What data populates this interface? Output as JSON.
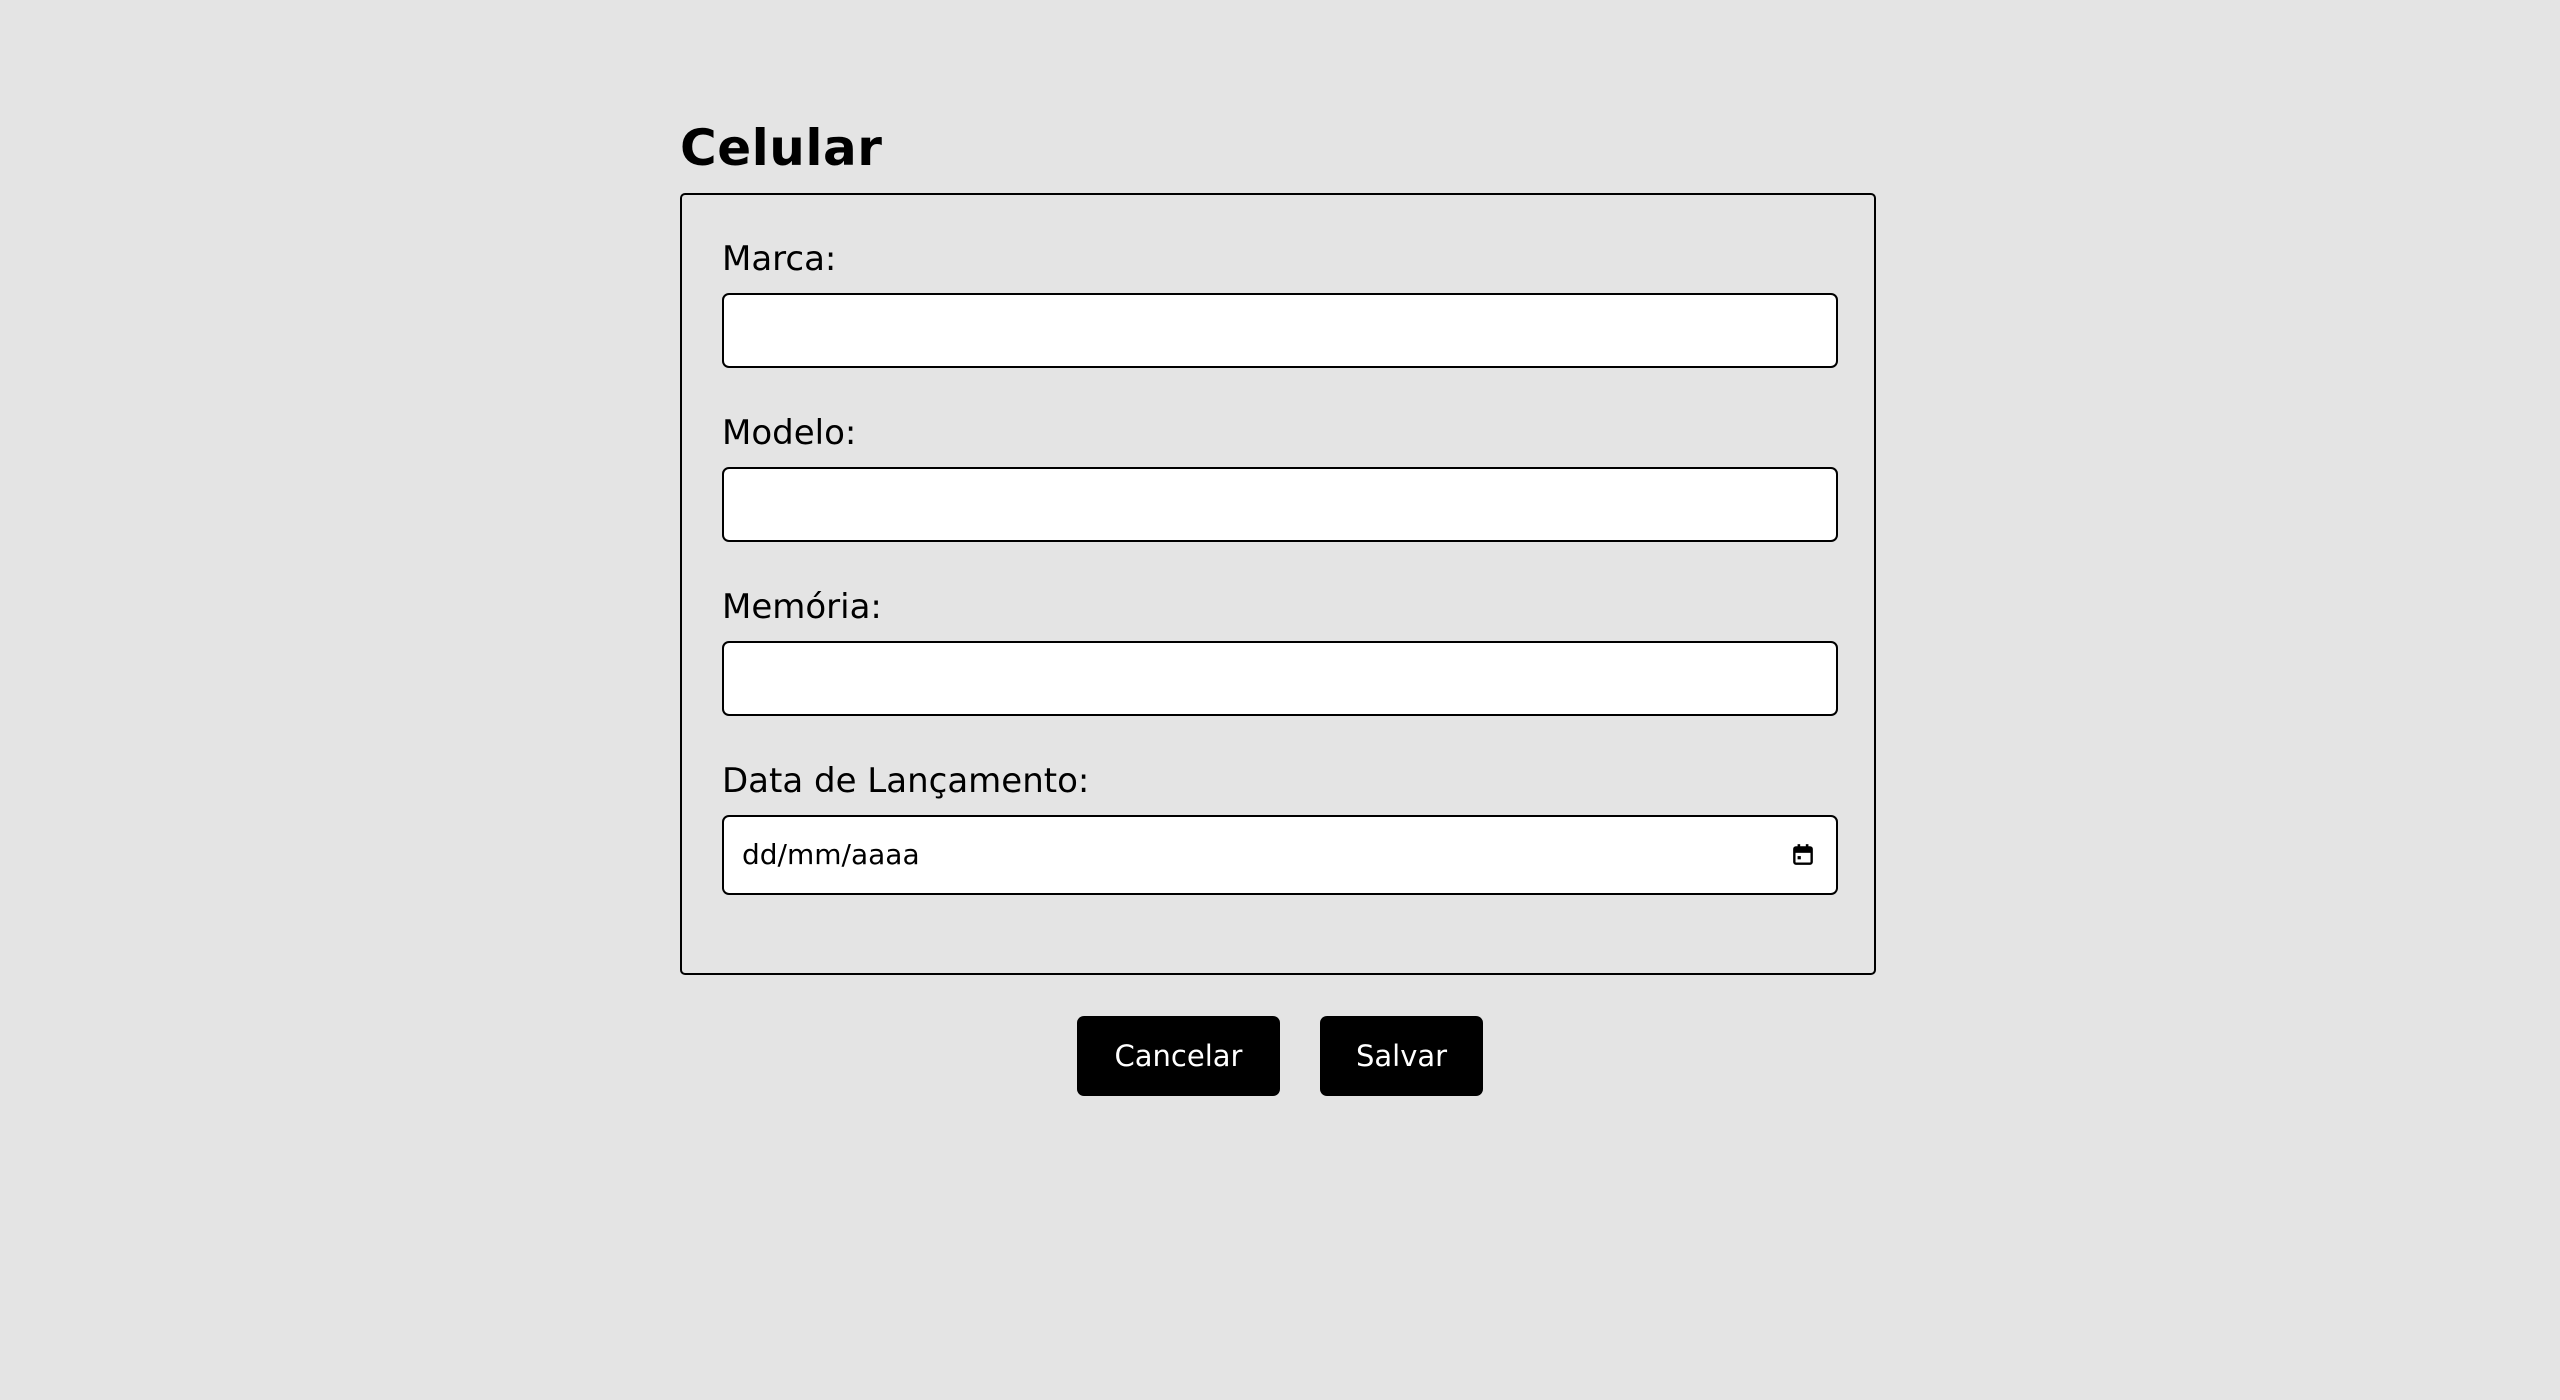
{
  "page": {
    "title": "Celular"
  },
  "form": {
    "fields": [
      {
        "label": "Marca:",
        "value": ""
      },
      {
        "label": "Modelo:",
        "value": ""
      },
      {
        "label": "Memória:",
        "value": ""
      },
      {
        "label": "Data de Lançamento:",
        "value": "",
        "placeholder": "dd/mm/aaaa",
        "icon": "calendar-icon"
      }
    ]
  },
  "actions": {
    "cancel_label": "Cancelar",
    "save_label": "Salvar"
  },
  "colors": {
    "background": "#e4e4e4",
    "input_background": "#ffffff",
    "border": "#000000",
    "button_background": "#000000",
    "button_text": "#ffffff"
  }
}
